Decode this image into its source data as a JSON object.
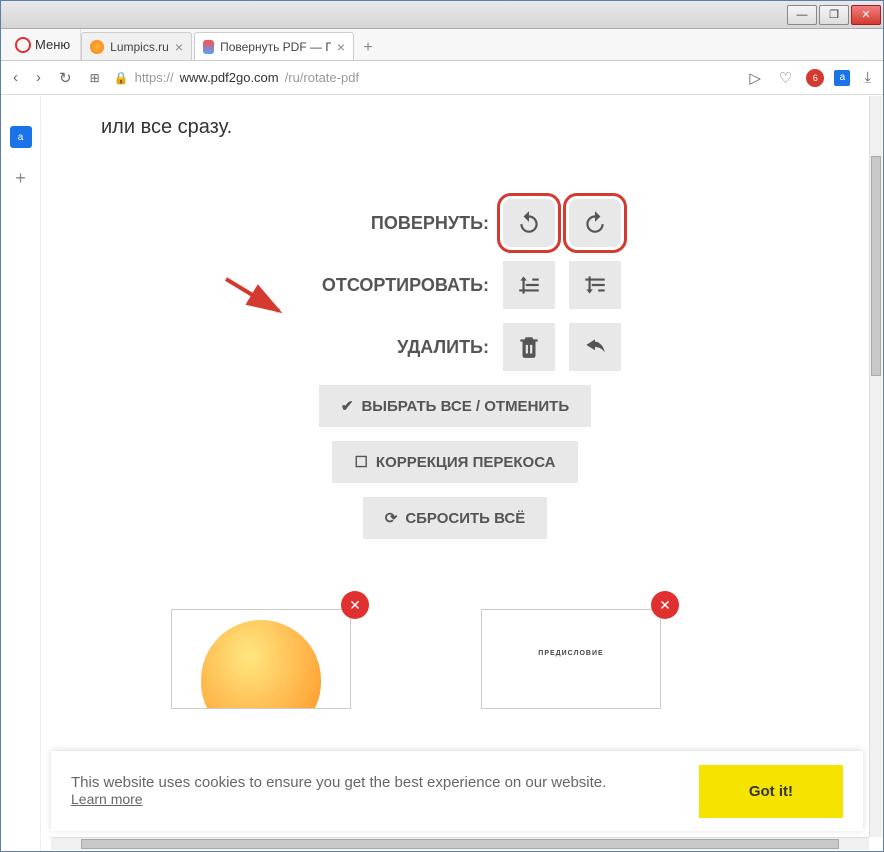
{
  "window": {
    "menu_label": "Меню"
  },
  "tabs": [
    {
      "title": "Lumpics.ru"
    },
    {
      "title": "Повернуть PDF — Повор"
    }
  ],
  "url": {
    "scheme": "https://",
    "host": "www.pdf2go.com",
    "path": "/ru/rotate-pdf"
  },
  "badge_count": "6",
  "translate_label": "а",
  "intro": "или все сразу.",
  "controls": {
    "rotate_label": "ПОВЕРНУТЬ:",
    "sort_label": "ОТСОРТИРОВАТЬ:",
    "delete_label": "УДАЛИТЬ:",
    "select_all": "ВЫБРАТЬ ВСЕ / ОТМЕНИТЬ",
    "deskew": "КОРРЕКЦИЯ ПЕРЕКОСА",
    "reset": "СБРОСИТЬ ВСЁ"
  },
  "thumb2_caption": "ПРЕДИСЛОВИЕ",
  "cookie": {
    "text": "This website uses cookies to ensure you get the best experience on our website.",
    "learn_more": "Learn more",
    "accept": "Got it!"
  }
}
